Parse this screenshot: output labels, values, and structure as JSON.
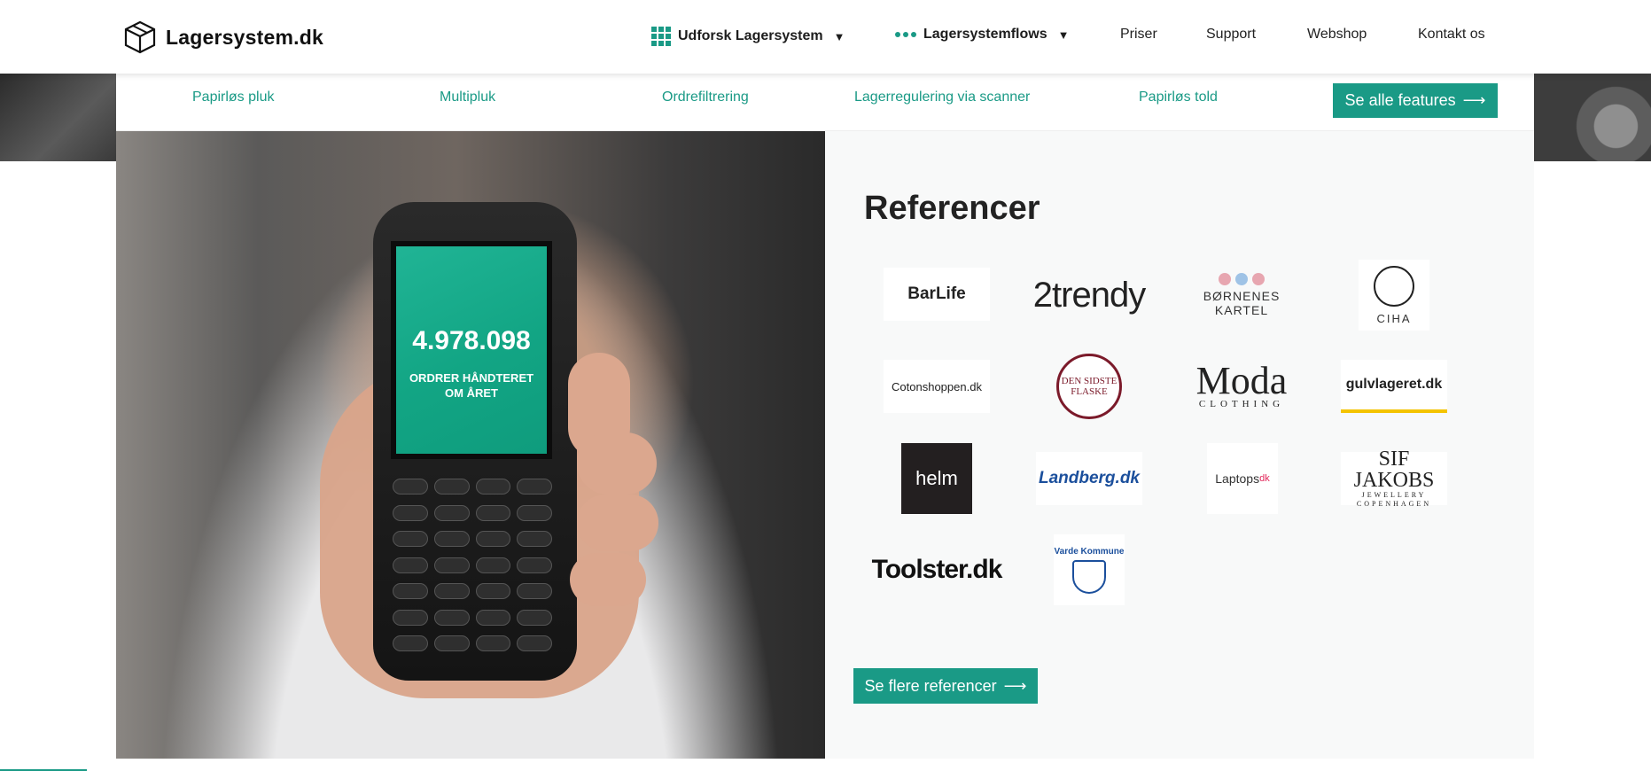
{
  "header": {
    "logo_text": "Lagersystem.dk",
    "nav": [
      {
        "label": "Udforsk Lagersystem",
        "icon": "grid-icon",
        "dropdown": true
      },
      {
        "label": "Lagersystemflows",
        "icon": "dots-icon",
        "dropdown": true
      },
      {
        "label": "Priser"
      },
      {
        "label": "Support"
      },
      {
        "label": "Webshop"
      },
      {
        "label": "Kontakt os"
      }
    ]
  },
  "features": {
    "items": [
      "Papirløs pluk",
      "Multipluk",
      "Ordrefiltrering",
      "Lagerregulering via scanner",
      "Papirløs told"
    ],
    "cta_label": "Se alle features"
  },
  "hero": {
    "phone_number": "4.978.098",
    "phone_label": "ORDRER HÅNDTERET OM ÅRET"
  },
  "references": {
    "title": "Referencer",
    "logos": {
      "barlife": "BarLife",
      "trendy": "2trendy",
      "bornenes": "BØRNENES KARTEL",
      "ciha": "CIHA",
      "coton": "Cotonshoppen.dk",
      "sidste": "DEN SIDSTE FLASKE",
      "moda": "Moda",
      "moda_sub": "CLOTHING",
      "gulv": "gulvlageret.dk",
      "helm": "helm",
      "landberg": "Landberg.dk",
      "laptops": "Laptops",
      "laptops_sub": "dk",
      "sif": "SIF JAKOBS",
      "sif_sub": "JEWELLERY COPENHAGEN",
      "toolster": "Toolster.dk",
      "varde": "Varde Kommune"
    },
    "cta_label": "Se flere referencer"
  },
  "colors": {
    "accent": "#1a9a86",
    "text": "#222222"
  }
}
